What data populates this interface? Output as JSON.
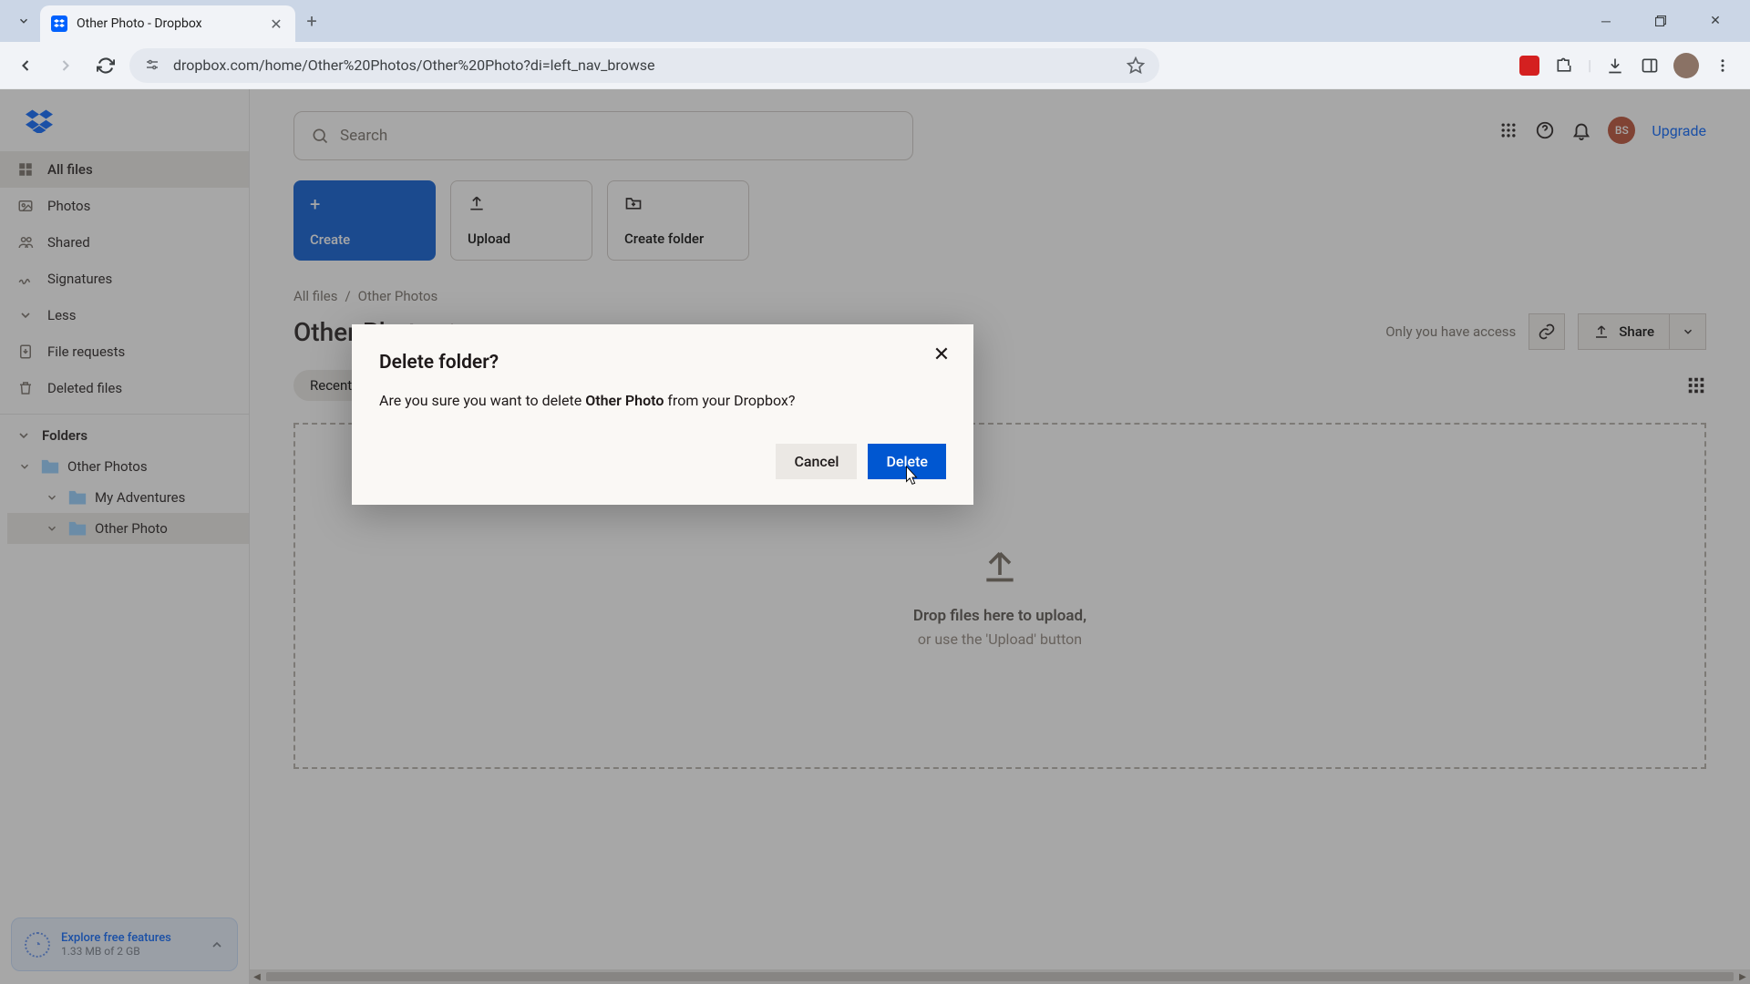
{
  "browser": {
    "tab_title": "Other Photo - Dropbox",
    "url": "dropbox.com/home/Other%20Photos/Other%20Photo?di=left_nav_browse"
  },
  "sidebar": {
    "items": [
      {
        "label": "All files"
      },
      {
        "label": "Photos"
      },
      {
        "label": "Shared"
      },
      {
        "label": "Signatures"
      },
      {
        "label": "Less"
      },
      {
        "label": "File requests"
      },
      {
        "label": "Deleted files"
      }
    ],
    "folders_label": "Folders",
    "tree": [
      {
        "label": "Other Photos"
      },
      {
        "label": "My Adventures"
      },
      {
        "label": "Other Photo"
      }
    ],
    "explore": {
      "title": "Explore free features",
      "subtitle": "1.33 MB of 2 GB"
    }
  },
  "header": {
    "search_placeholder": "Search",
    "avatar_initials": "BS",
    "upgrade": "Upgrade"
  },
  "actions": {
    "create": "Create",
    "upload": "Upload",
    "create_folder": "Create folder"
  },
  "breadcrumb": {
    "root": "All files",
    "parent": "Other Photos"
  },
  "page": {
    "title": "Other Photo",
    "access": "Only you have access",
    "share": "Share",
    "recents": "Recents"
  },
  "dropzone": {
    "line1": "Drop files here to upload,",
    "line2": "or use the 'Upload' button"
  },
  "modal": {
    "title": "Delete folder?",
    "body_before": "Are you sure you want to delete ",
    "body_bold": "Other Photo",
    "body_after": " from your Dropbox?",
    "cancel": "Cancel",
    "delete": "Delete"
  }
}
